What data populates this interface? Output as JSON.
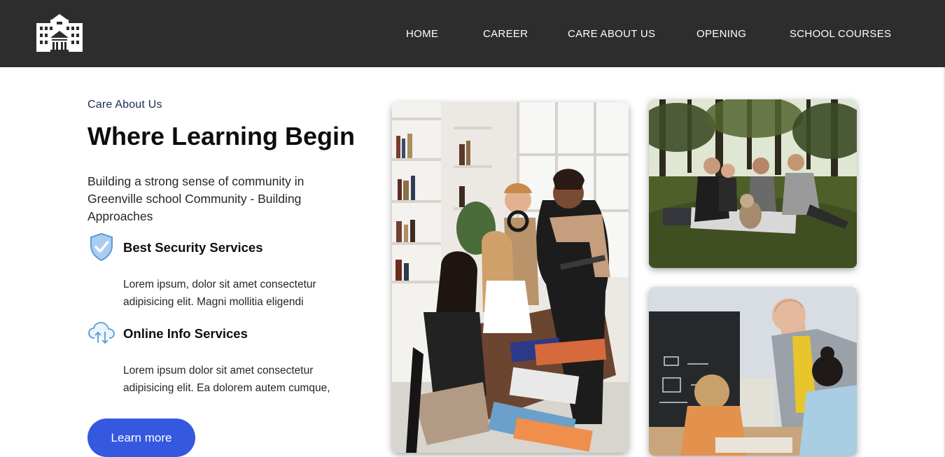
{
  "nav": {
    "logo_icon": "school-building-icon",
    "items": [
      "HOME",
      "CAREER",
      "CARE ABOUT US",
      "OPENING",
      "SCHOOL COURSES"
    ]
  },
  "hero": {
    "eyebrow": "Care About Us",
    "title": "Where Learning Begin",
    "lead": "Building a strong sense of community in Greenville school Community - Building Approaches"
  },
  "features": [
    {
      "icon": "shield-check-icon",
      "title": "Best Security Services",
      "description": "Lorem ipsum, dolor sit amet consectetur adipisicing elit. Magni mollitia eligendi"
    },
    {
      "icon": "cloud-transfer-icon",
      "title": "Online Info Services",
      "description": "Lorem ipsum dolor sit amet consectetur adipisicing elit. Ea dolorem autem cumque,"
    }
  ],
  "cta": {
    "label": "Learn more"
  },
  "images": [
    {
      "name": "students-study-group-photo"
    },
    {
      "name": "friends-picnic-park-photo"
    },
    {
      "name": "teacher-classroom-photo"
    }
  ],
  "colors": {
    "navbar": "#2d2d2d",
    "accent": "#3558e0",
    "eyebrow": "#1d2b52",
    "icon_blue": "#5b9bd5"
  }
}
